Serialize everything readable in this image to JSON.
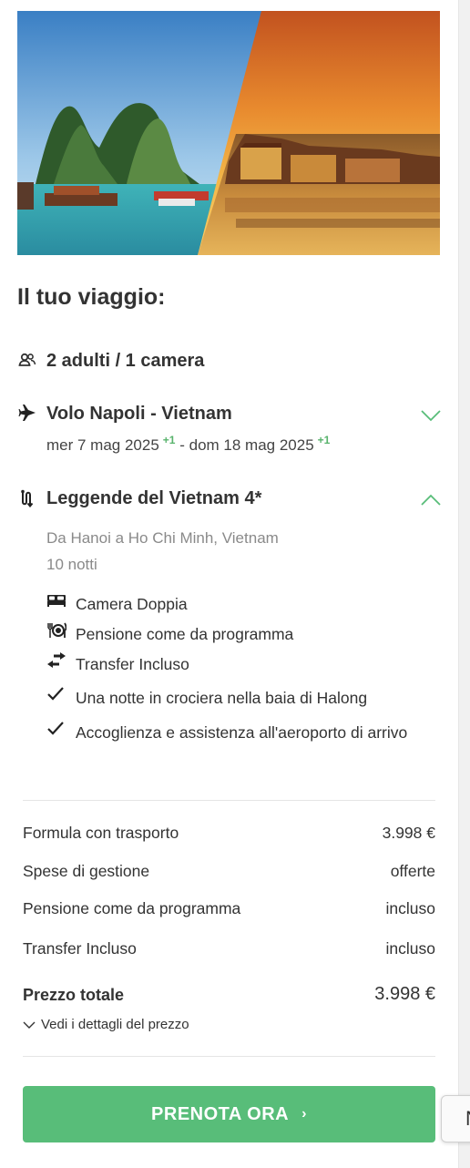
{
  "hero": {
    "image_name": "vietnam-halong-hoian-banner"
  },
  "trip": {
    "title": "Il tuo viaggio:",
    "travelers": "2 adulti / 1 camera",
    "flight": {
      "title": "Volo Napoli - Vietnam",
      "depart": "mer 7 mag 2025",
      "depart_plus": "+1",
      "separator": "-",
      "return": "dom 18 mag 2025",
      "return_plus": "+1"
    },
    "tour": {
      "title": "Leggende del Vietnam 4*",
      "route": "Da Hanoi a Ho Chi Minh, Vietnam",
      "nights": "10 notti",
      "features": [
        {
          "icon": "bed-icon",
          "label": "Camera Doppia"
        },
        {
          "icon": "cutlery-icon",
          "label": "Pensione come da programma"
        },
        {
          "icon": "transfer-icon",
          "label": "Transfer Incluso"
        },
        {
          "icon": "check-icon",
          "label": "Una notte in crociera nella baia di Halong"
        },
        {
          "icon": "check-icon",
          "label": "Accoglienza e assistenza all'aeroporto di arrivo"
        }
      ]
    }
  },
  "pricing": {
    "rows": [
      {
        "label": "Formula con trasporto",
        "value": "3.998 €"
      },
      {
        "label": "Spese di gestione",
        "value": "offerte"
      },
      {
        "label": "Pensione come da programma",
        "value": "incluso"
      },
      {
        "label": "Transfer Incluso",
        "value": "incluso"
      }
    ],
    "total_label": "Prezzo totale",
    "total_value": "3.998 €",
    "details_link": "Vedi i dettagli del prezzo"
  },
  "cta": {
    "label": "PRENOTA ORA"
  },
  "side_tab": {
    "label": "N"
  },
  "colors": {
    "accent": "#58bd79",
    "plus_green": "#58b36c",
    "text": "#333333",
    "muted": "#8a8a8a"
  }
}
